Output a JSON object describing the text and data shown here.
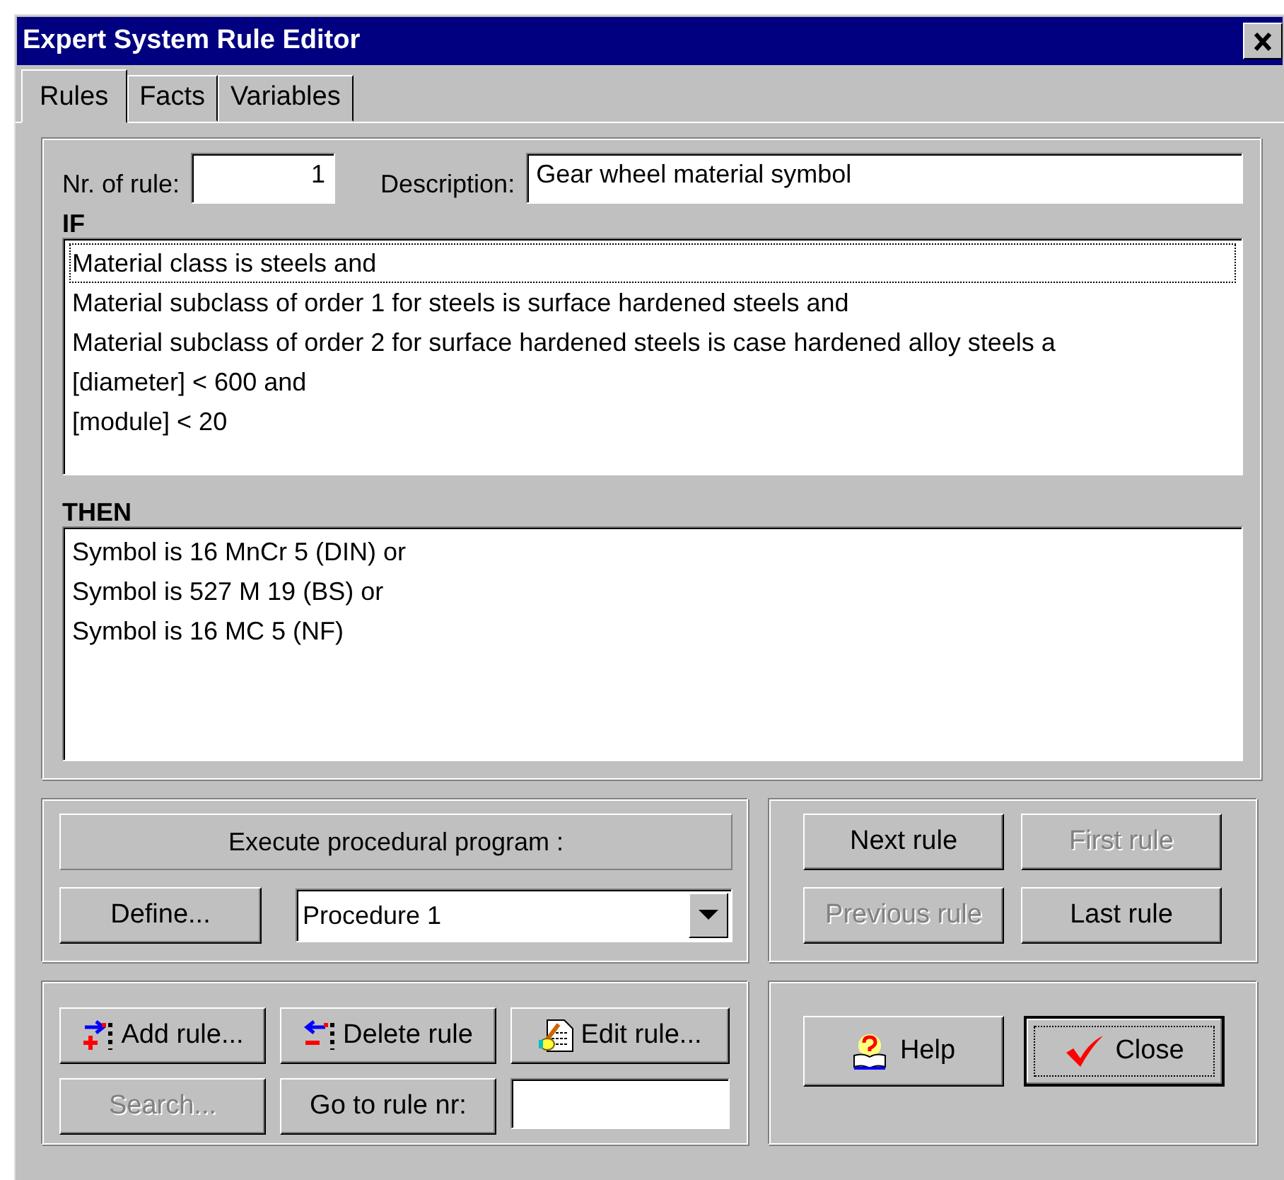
{
  "window": {
    "title": "Expert System Rule Editor"
  },
  "tabs": [
    {
      "label": "Rules",
      "selected": true
    },
    {
      "label": "Facts",
      "selected": false
    },
    {
      "label": "Variables",
      "selected": false
    }
  ],
  "rule": {
    "number_label": "Nr. of rule:",
    "number": "1",
    "description_label": "Description:",
    "description": "Gear wheel material symbol"
  },
  "if_section": {
    "label": "IF",
    "lines": [
      {
        "text": "Material class is steels and",
        "focused": true
      },
      {
        "text": "Material subclass of order 1 for steels is surface hardened steels and",
        "focused": false
      },
      {
        "text": "Material subclass of order 2 for surface hardened steels is case hardened alloy steels a",
        "focused": false
      },
      {
        "text": "[diameter] < 600 and",
        "focused": false
      },
      {
        "text": "[module] < 20",
        "focused": false
      }
    ]
  },
  "then_section": {
    "label": "THEN",
    "lines": [
      {
        "text": "Symbol is 16 MnCr 5  (DIN) or",
        "focused": false
      },
      {
        "text": "Symbol is 527 M 19 (BS) or",
        "focused": false
      },
      {
        "text": "Symbol is 16 MC 5 (NF)",
        "focused": false
      }
    ]
  },
  "procedure": {
    "label": "Execute procedural program :",
    "define_button": "Define...",
    "selected_procedure": "Procedure 1"
  },
  "navigation_buttons": [
    {
      "label": "Next rule",
      "disabled": false
    },
    {
      "label": "First rule",
      "disabled": true
    },
    {
      "label": "Previous rule",
      "disabled": true
    },
    {
      "label": "Last rule",
      "disabled": false
    }
  ],
  "rule_buttons": [
    {
      "label": "Add rule...",
      "kind": "add",
      "disabled": false
    },
    {
      "label": "Delete rule",
      "kind": "delete",
      "disabled": false
    },
    {
      "label": "Edit rule...",
      "kind": "edit",
      "disabled": false
    },
    {
      "label": "Search...",
      "kind": "plain",
      "disabled": true
    },
    {
      "label": "Go to rule nr:",
      "kind": "plain",
      "disabled": false
    }
  ],
  "dialog_buttons": [
    {
      "label": "Help",
      "kind": "help",
      "focused": false
    },
    {
      "label": "Close",
      "kind": "close",
      "focused": true
    }
  ]
}
